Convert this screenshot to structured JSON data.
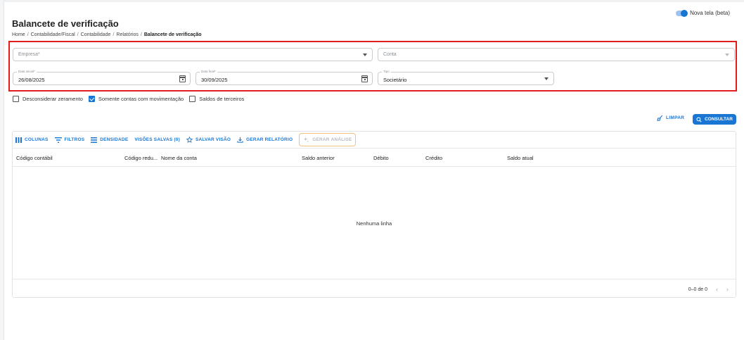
{
  "toggle": {
    "label": "Nova tela (beta)"
  },
  "page": {
    "title": "Balancete de verificação"
  },
  "breadcrumb": {
    "items": [
      "Home",
      "Contabilidade/Fiscal",
      "Contabilidade",
      "Relatórios",
      "Balancete de verificação"
    ]
  },
  "filters": {
    "empresa": {
      "placeholder": "Empresa*"
    },
    "conta": {
      "placeholder": "Conta"
    },
    "data_inicial": {
      "label": "Data inicial*",
      "value": "26/08/2025"
    },
    "data_final": {
      "label": "Data final*",
      "value": "30/09/2025"
    },
    "tipo": {
      "label": "Tipo",
      "value": "Societário"
    }
  },
  "checkboxes": [
    {
      "label": "Desconsiderar zeramento",
      "checked": false
    },
    {
      "label": "Somente contas com movimentação",
      "checked": true
    },
    {
      "label": "Saldos de terceiros",
      "checked": false
    }
  ],
  "actions": {
    "limpar": "LIMPAR",
    "consultar": "CONSULTAR"
  },
  "toolbar": {
    "colunas": "COLUNAS",
    "filtros": "FILTROS",
    "densidade": "DENSIDADE",
    "visoes": "VISÕES SALVAS (0)",
    "salvar": "SALVAR VISÃO",
    "gerar_relatorio": "GERAR RELATÓRIO",
    "gerar_analise": "GERAR ANÁLISE"
  },
  "table": {
    "columns": [
      "Código contábil",
      "Código redu...",
      "Nome da conta",
      "Saldo anterior",
      "Débito",
      "Crédito",
      "Saldo atual"
    ],
    "empty_text": "Nenhuma linha",
    "pagination": "0–0 de 0"
  },
  "colors": {
    "accent": "#1976d2",
    "highlight": "#e01e1e"
  }
}
